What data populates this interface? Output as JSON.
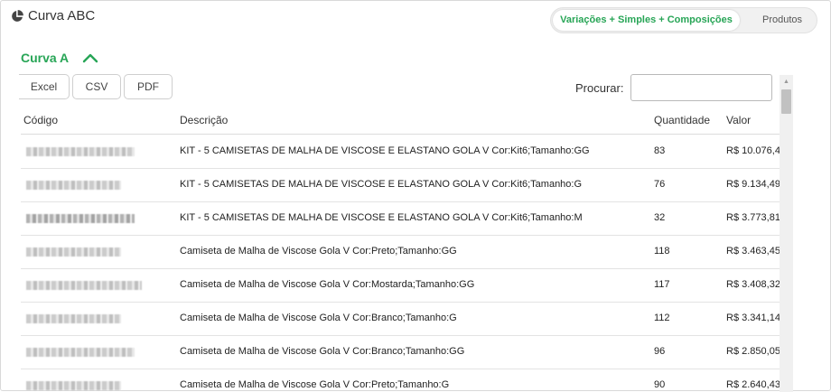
{
  "app": {
    "title": "Curva ABC",
    "icon": "pie-chart-icon"
  },
  "toggle": {
    "active_label": "Variações + Simples + Composições",
    "inactive_label": "Produtos",
    "accent_color": "#27a556"
  },
  "section": {
    "title": "Curva A",
    "icon": "chevron-up-icon"
  },
  "export": {
    "excel": "Excel",
    "csv": "CSV",
    "pdf": "PDF"
  },
  "search": {
    "label": "Procurar:",
    "value": ""
  },
  "table": {
    "headers": {
      "codigo": "Código",
      "descricao": "Descrição",
      "quantidade": "Quantidade",
      "valor": "Valor"
    },
    "rows": [
      {
        "descricao": "KIT - 5 CAMISETAS DE MALHA DE VISCOSE E ELASTANO GOLA V Cor:Kit6;Tamanho:GG",
        "quantidade": "83",
        "valor": "R$ 10.076,4"
      },
      {
        "descricao": "KIT - 5 CAMISETAS DE MALHA DE VISCOSE E ELASTANO GOLA V Cor:Kit6;Tamanho:G",
        "quantidade": "76",
        "valor": "R$ 9.134,49"
      },
      {
        "descricao": "KIT - 5 CAMISETAS DE MALHA DE VISCOSE E ELASTANO GOLA V Cor:Kit6;Tamanho:M",
        "quantidade": "32",
        "valor": "R$ 3.773,81"
      },
      {
        "descricao": "Camiseta de Malha de Viscose Gola V Cor:Preto;Tamanho:GG",
        "quantidade": "118",
        "valor": "R$ 3.463,45"
      },
      {
        "descricao": "Camiseta de Malha de Viscose Gola V Cor:Mostarda;Tamanho:GG",
        "quantidade": "117",
        "valor": "R$ 3.408,32"
      },
      {
        "descricao": "Camiseta de Malha de Viscose Gola V Cor:Branco;Tamanho:G",
        "quantidade": "112",
        "valor": "R$ 3.341,14"
      },
      {
        "descricao": "Camiseta de Malha de Viscose Gola V Cor:Branco;Tamanho:GG",
        "quantidade": "96",
        "valor": "R$ 2.850,05"
      },
      {
        "descricao": "Camiseta de Malha de Viscose Gola V Cor:Preto;Tamanho:G",
        "quantidade": "90",
        "valor": "R$ 2.640,43"
      }
    ]
  }
}
